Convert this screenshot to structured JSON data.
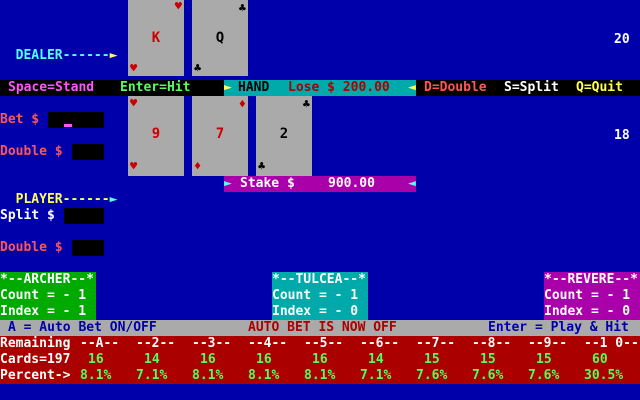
{
  "dealer": {
    "label": "DEALER------",
    "total": "20",
    "cards": [
      {
        "rank": "K",
        "suit": "heart"
      },
      {
        "rank": "Q",
        "suit": "club"
      }
    ]
  },
  "player": {
    "label": "PLAYER------",
    "total": "18",
    "cards": [
      {
        "rank": "9",
        "suit": "heart"
      },
      {
        "rank": "7",
        "suit": "diamond"
      },
      {
        "rank": "2",
        "suit": "club"
      }
    ]
  },
  "controls": {
    "stand": "Space=Stand",
    "hit": "Enter=Hit",
    "double": "D=Double",
    "split": "S=Split",
    "quit": "Q=Quit"
  },
  "hand_status": {
    "hand": "HAND",
    "result": "Lose $ 200.00"
  },
  "left_labels": {
    "bet": "Bet $",
    "double1": "Double $",
    "split": "Split $",
    "double2": "Double $"
  },
  "stake": {
    "label": "Stake $",
    "value": "900.00"
  },
  "counters": [
    {
      "title": "*--ARCHER--*",
      "count": "Count = - 1",
      "index": "Index = - 1"
    },
    {
      "title": "*--TULCEA--*",
      "count": "Count = - 1",
      "index": "Index = - 0"
    },
    {
      "title": "*--REVERE--*",
      "count": "Count = - 1",
      "index": "Index = - 0"
    }
  ],
  "autobet": {
    "toggle": "A = Auto Bet ON/OFF",
    "status": "AUTO BET IS NOW OFF",
    "play": "Enter = Play & Hit"
  },
  "stats": {
    "remaining_label": "Remaining",
    "headers": [
      "--A--",
      "--2--",
      "--3--",
      "--4--",
      "--5--",
      "--6--",
      "--7--",
      "--8--",
      "--9--",
      "--1 0--"
    ],
    "cards_label": "Cards=197",
    "cards": [
      "16",
      "14",
      "16",
      "16",
      "16",
      "14",
      "15",
      "15",
      "15",
      "60"
    ],
    "percent_label": "Percent->",
    "percent": [
      "8.1%",
      "7.1%",
      "8.1%",
      "8.1%",
      "8.1%",
      "7.1%",
      "7.6%",
      "7.6%",
      "7.6%",
      "30.5%"
    ]
  },
  "colors": {
    "background": "#0000aa",
    "card": "#aaaaaa",
    "cyan": "#00aaaa",
    "magenta": "#aa00aa",
    "green": "#00aa00",
    "red_bar": "#aa0000"
  }
}
